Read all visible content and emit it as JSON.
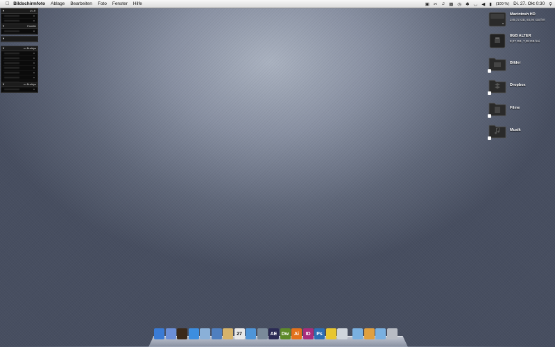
{
  "menubar": {
    "app_name": "Bildschirmfoto",
    "menus": [
      "Ablage",
      "Bearbeiten",
      "Foto",
      "Fenster",
      "Hilfe"
    ],
    "battery_text": "(100 %)",
    "clock": "Di. 27. Okt  0:30"
  },
  "buddy_lists": [
    {
      "title": "V.I.P."
    },
    {
      "title": "Familie"
    },
    {
      "title": "m Buddys"
    },
    {
      "title": "m Buddys"
    }
  ],
  "desktop_items": [
    {
      "label": "Macintosh HD",
      "sub": "249,72 GB, 93,94 GB frei",
      "icon": "hard-drive-icon"
    },
    {
      "label": "8GB ALTER",
      "sub": "8,07 GB, 7,38 GB frei",
      "icon": "usb-drive-icon"
    },
    {
      "label": "Bilder",
      "sub": "",
      "icon": "pictures-folder-icon"
    },
    {
      "label": "Dropbox",
      "sub": "",
      "icon": "dropbox-folder-icon"
    },
    {
      "label": "Filme",
      "sub": "",
      "icon": "movies-folder-icon"
    },
    {
      "label": "Musik",
      "sub": "",
      "icon": "music-folder-icon"
    }
  ],
  "dock": {
    "apps": [
      {
        "name": "finder",
        "text": "",
        "color": "#3a7bd5"
      },
      {
        "name": "preview",
        "text": "",
        "color": "#6b8fd8"
      },
      {
        "name": "adium",
        "text": "",
        "color": "#3b2a1a"
      },
      {
        "name": "safari",
        "text": "",
        "color": "#3d8ee0"
      },
      {
        "name": "mail",
        "text": "",
        "color": "#8ab0d8"
      },
      {
        "name": "ical-addressbook",
        "text": "",
        "color": "#4f7fbf"
      },
      {
        "name": "notes",
        "text": "",
        "color": "#d6b36a"
      },
      {
        "name": "ical",
        "text": "27",
        "color": "#e8e8e8"
      },
      {
        "name": "itunes",
        "text": "",
        "color": "#4f95d8"
      },
      {
        "name": "iphoto",
        "text": "",
        "color": "#7a8a9a"
      },
      {
        "name": "after-effects",
        "text": "AE",
        "color": "#2b2b55"
      },
      {
        "name": "dreamweaver",
        "text": "Dw",
        "color": "#5e8a2a"
      },
      {
        "name": "illustrator",
        "text": "Ai",
        "color": "#e3721c"
      },
      {
        "name": "indesign",
        "text": "ID",
        "color": "#a82d7c"
      },
      {
        "name": "photoshop",
        "text": "Ps",
        "color": "#2d6fb5"
      },
      {
        "name": "cyberduck",
        "text": "",
        "color": "#e8c630"
      },
      {
        "name": "textedit",
        "text": "",
        "color": "#cfd5dc"
      }
    ],
    "stacks": [
      {
        "name": "applications-stack",
        "color": "#7ab0e0"
      },
      {
        "name": "documents-stack",
        "color": "#e0a040"
      },
      {
        "name": "downloads-stack",
        "color": "#7ab0e0"
      },
      {
        "name": "trash",
        "color": "#b8bcc4"
      }
    ]
  }
}
